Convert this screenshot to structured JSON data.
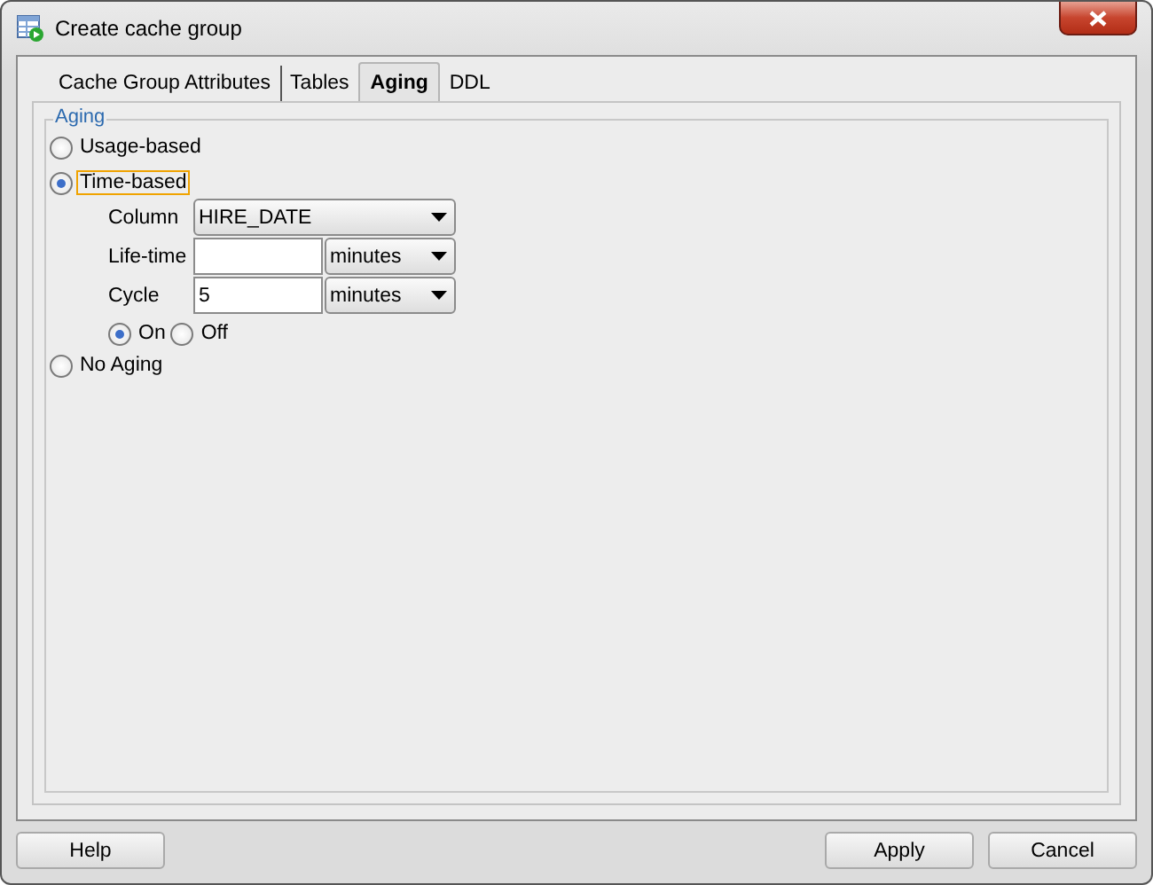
{
  "window": {
    "title": "Create cache group"
  },
  "tabs": [
    {
      "label": "Cache Group Attributes",
      "selected": false
    },
    {
      "label": "Tables",
      "selected": false
    },
    {
      "label": "Aging",
      "selected": true
    },
    {
      "label": "DDL",
      "selected": false
    }
  ],
  "aging": {
    "title": "Aging",
    "options": [
      {
        "label": "Usage-based",
        "selected": false,
        "focused": false
      },
      {
        "label": "Time-based",
        "selected": true,
        "focused": true
      },
      {
        "label": "No Aging",
        "selected": false,
        "focused": false
      }
    ],
    "column": {
      "label": "Column",
      "value": "HIRE_DATE"
    },
    "lifetime": {
      "label": "Life-time",
      "unit": "minutes"
    },
    "cycle": {
      "label": "Cycle",
      "value": "5",
      "unit": "minutes"
    },
    "cycle_state": [
      {
        "label": "On",
        "selected": true
      },
      {
        "label": "Off",
        "selected": false
      }
    ]
  },
  "buttons": {
    "left": [
      "Help"
    ],
    "right": [
      "Apply",
      "Cancel"
    ]
  }
}
